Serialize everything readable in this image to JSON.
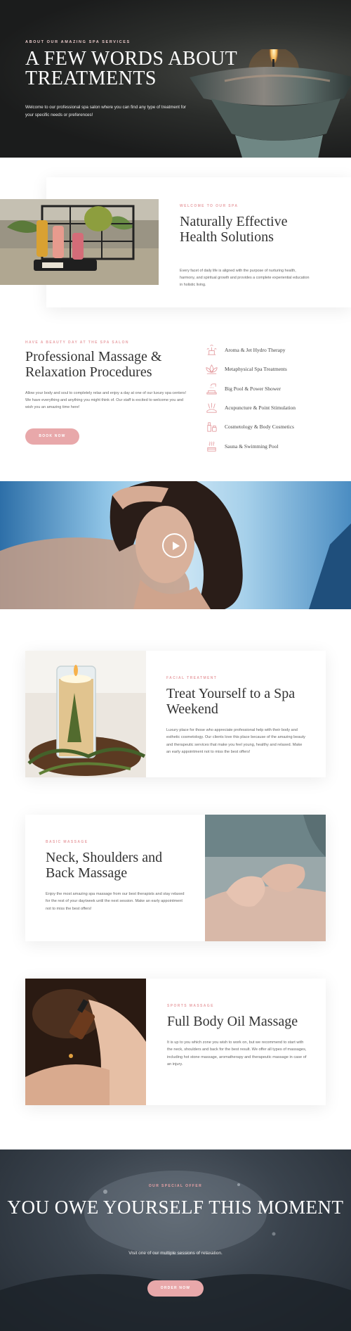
{
  "hero": {
    "overline": "ABOUT OUR AMAZING SPA SERVICES",
    "title": "A FEW WORDS ABOUT TREATMENTS",
    "text": "Welcome to our professional spa salon where you can find any type of treatment for your specific needs or preferences!"
  },
  "natural": {
    "overline": "WELCOME TO OUR SPA",
    "title": "Naturally Effective Health Solutions",
    "text": "Every facet of daily life is aligned with the purpose of nurturing health, harmony, and spiritual growth and provides a complete experiential education in holistic living."
  },
  "professional": {
    "overline": "HAVE A BEAUTY DAY AT THE SPA SALON",
    "title": "Professional Massage & Relaxation Procedures",
    "text": "Allow your body and soul to completely relax and enjoy a day at one of our luxury spa centers! We have everything and anything you might think of. Our staff is excited to welcome you and wish you an amazing time here!",
    "button": "BOOK NOW",
    "services": [
      {
        "label": "Aroma & Jet Hydro Therapy",
        "icon": "aroma-icon"
      },
      {
        "label": "Metaphysical Spa Treatments",
        "icon": "lotus-icon"
      },
      {
        "label": "Big Pool & Power Shower",
        "icon": "shower-icon"
      },
      {
        "label": "Acupuncture & Point Stimulation",
        "icon": "acupuncture-icon"
      },
      {
        "label": "Cosmetology & Body Cosmetics",
        "icon": "cosmetics-icon"
      },
      {
        "label": "Sauna & Swimming Pool",
        "icon": "sauna-icon"
      }
    ]
  },
  "video": {
    "icon": "play-icon"
  },
  "features": [
    {
      "overline": "FACIAL TREATMENT",
      "title": "Treat Yourself to a Spa Weekend",
      "text": "Luxury place for those who appreciate professional help with their body and esthetic cosmetology. Our clients love this place because of the amazing beauty and therapeutic services that make you feel young, healthy and relaxed. Make an early appointment not to miss the best offers!"
    },
    {
      "overline": "BASIC MASSAGE",
      "title": "Neck, Shoulders and Back Massage",
      "text": "Enjoy the most amazing spa massage from our best therapists and stay relaxed for the rest of your day/week until the next session. Make an early appointment not to miss the best offers!"
    },
    {
      "overline": "SPORTS MASSAGE",
      "title": "Full Body Oil Massage",
      "text": "It is up to you which zone you wish to work on, but we recommend to start with the neck, shoulders and back for the best result. We offer all types of massages, including hot stone massage, aromatherapy and therapeutic massage in case of an injury."
    }
  ],
  "offer": {
    "overline": "OUR SPECIAL OFFER",
    "title": "YOU OWE YOURSELF THIS MOMENT",
    "text": "Visit one of our multiple sessions of relaxation.",
    "button": "ORDER NOW"
  },
  "colors": {
    "accent": "#e8a8aa",
    "heading": "#333333",
    "dark": "#1e1f1f"
  }
}
